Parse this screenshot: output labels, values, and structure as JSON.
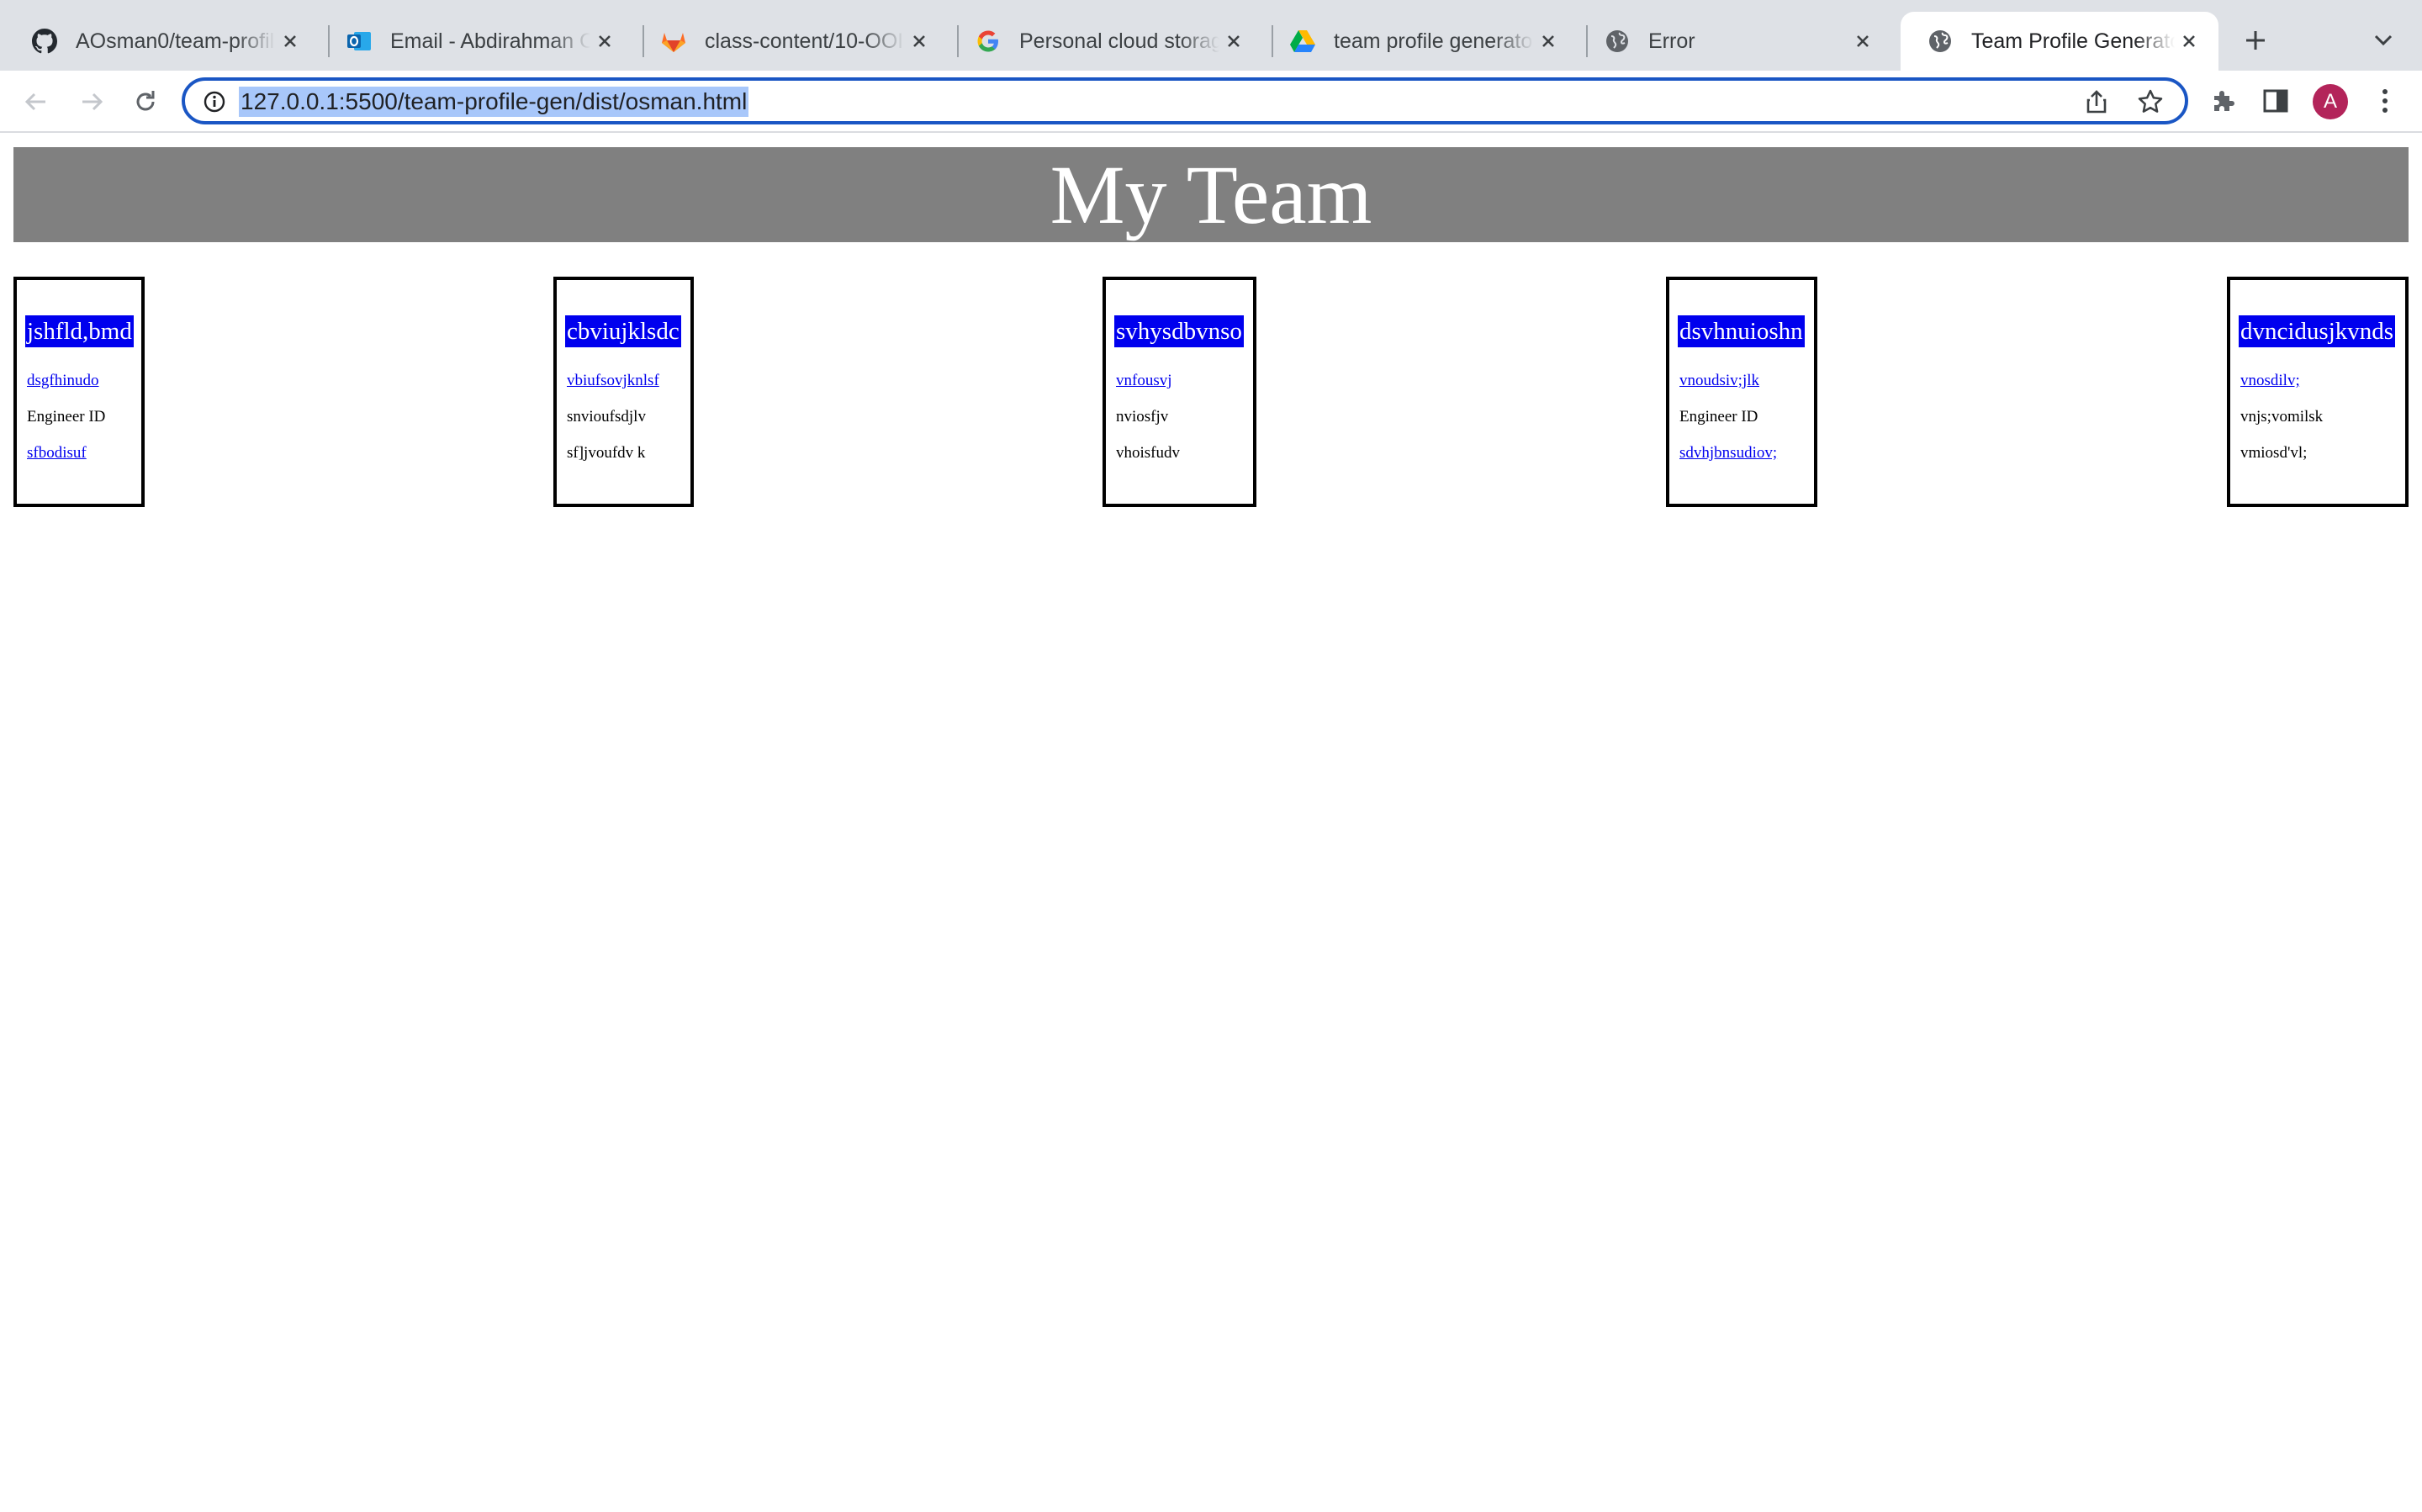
{
  "browser": {
    "tabs": [
      {
        "title": "AOsman0/team-profil",
        "icon": "github-icon"
      },
      {
        "title": "Email - Abdirahman O",
        "icon": "outlook-icon"
      },
      {
        "title": "class-content/10-OOI",
        "icon": "gitlab-icon"
      },
      {
        "title": "Personal cloud storag",
        "icon": "google-icon"
      },
      {
        "title": "team profile generato",
        "icon": "google-drive-icon"
      },
      {
        "title": "Error",
        "icon": "globe-icon"
      },
      {
        "title": "Team Profile Generato",
        "icon": "globe-icon",
        "active": true
      }
    ],
    "url": "127.0.0.1:5500/team-profile-gen/dist/osman.html",
    "profile_initial": "A",
    "accent_color": "#1a56c4"
  },
  "page": {
    "title": "My Team",
    "header_bg": "#808080",
    "name_bg": "#0000ee",
    "cards": [
      {
        "name": "jshfld,bmd",
        "line1": "dsgfhinudo",
        "line2": "Engineer ID",
        "line3": "sfbodisuf"
      },
      {
        "name": "cbviujklsdc",
        "line1": "vbiufsovjknlsf",
        "line2": "snvioufsdjlv",
        "line3": "sf]jvoufdv k"
      },
      {
        "name": "svhysdbvnso",
        "line1": "vnfousvj",
        "line2": "nviosfjv",
        "line3": "vhoisfudv"
      },
      {
        "name": "dsvhnuioshn",
        "line1": "vnoudsiv;jlk",
        "line2": "Engineer ID",
        "line3": "sdvhjbnsudiov;"
      },
      {
        "name": "dvncidusjkvnds",
        "line1": "vnosdilv;",
        "line2": "vnjs;vomilsk",
        "line3": "vmiosd'vl;"
      }
    ]
  }
}
